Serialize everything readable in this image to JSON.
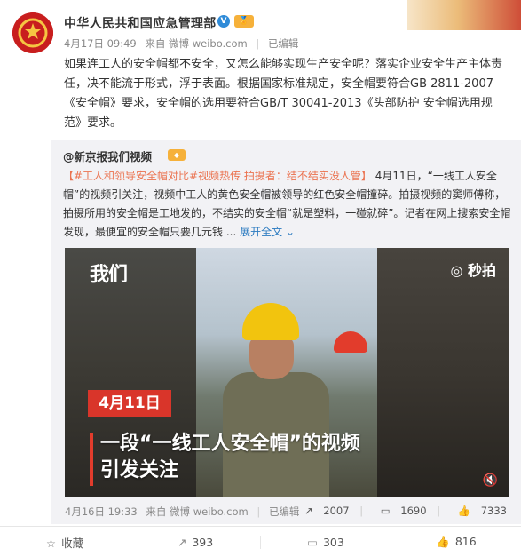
{
  "post": {
    "author": "中华人民共和国应急管理部",
    "verified_badge": "V",
    "level_badge": "🏅",
    "time": "4月17日 09:49",
    "source": "来自 微博 weibo.com",
    "edited": "已编辑",
    "text": "如果连工人的安全帽都不安全，又怎么能够实现生产安全呢？落实企业安全生产主体责任，决不能流于形式，浮于表面。根据国家标准规定，安全帽要符合GB 2811-2007《安全帽》要求，安全帽的选用要符合GB/T 30041-2013《头部防护 安全帽选用规范》要求。"
  },
  "repost": {
    "author": "@新京报我们视频",
    "topic1": "【#工人和领导安全帽对比#视频热传 拍摄者：结不结实没人管】",
    "body": "4月11日，“一线工人安全帽”的视频引关注，视频中工人的黄色安全帽被领导的红色安全帽撞碎。拍摄视频的窦师傅称，拍摄所用的安全帽是工地发的，不结实的安全帽“就是塑料，一碰就碎”。记者在网上搜索安全帽发现，最便宜的安全帽只要几元钱 ...",
    "expand": "展开全文",
    "video": {
      "logo_left": "我们",
      "logo_right": "秒拍",
      "date_label": "4月11日",
      "caption_line1": "一段“一线工人安全帽”的视频",
      "caption_line2": "引发关注"
    },
    "time": "4月16日 19:33",
    "source": "来自 微博 weibo.com",
    "edited": "已编辑",
    "reposts": "2007",
    "comments": "1690",
    "likes": "7333"
  },
  "actions": {
    "favorite": "收藏",
    "repost_count": "393",
    "comment_count": "303",
    "like_count": "816"
  }
}
